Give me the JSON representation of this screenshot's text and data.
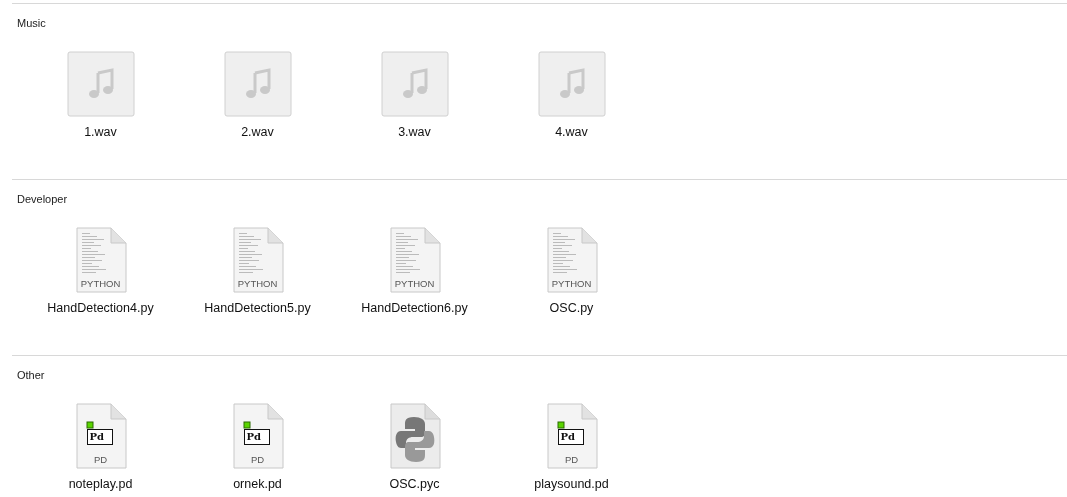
{
  "sections": [
    {
      "title": "Music",
      "items": [
        {
          "kind": "audio",
          "name": "1.wav"
        },
        {
          "kind": "audio",
          "name": "2.wav"
        },
        {
          "kind": "audio",
          "name": "3.wav"
        },
        {
          "kind": "audio",
          "name": "4.wav"
        }
      ]
    },
    {
      "title": "Developer",
      "items": [
        {
          "kind": "python",
          "name": "HandDetection4.py",
          "badge": "PYTHON"
        },
        {
          "kind": "python",
          "name": "HandDetection5.py",
          "badge": "PYTHON"
        },
        {
          "kind": "python",
          "name": "HandDetection6.py",
          "badge": "PYTHON"
        },
        {
          "kind": "python",
          "name": "OSC.py",
          "badge": "PYTHON"
        }
      ]
    },
    {
      "title": "Other",
      "items": [
        {
          "kind": "pd",
          "name": "noteplay.pd",
          "badge": "PD",
          "logo": "Pd"
        },
        {
          "kind": "pd",
          "name": "ornek.pd",
          "badge": "PD",
          "logo": "Pd"
        },
        {
          "kind": "pyc",
          "name": "OSC.pyc"
        },
        {
          "kind": "pd",
          "name": "playsound.pd",
          "badge": "PD",
          "logo": "Pd"
        }
      ]
    }
  ]
}
